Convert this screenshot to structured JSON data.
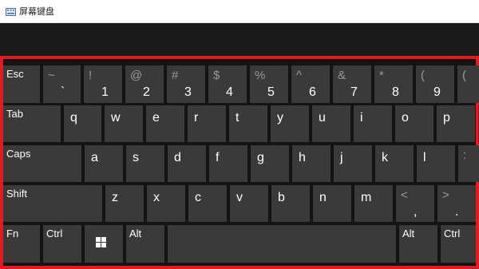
{
  "window": {
    "title": "屏幕键盘",
    "icon": "keyboard-icon"
  },
  "colors": {
    "highlight_border": "#e21b22",
    "key_bg": "#3a3a3a",
    "keyboard_bg": "#141414"
  },
  "keys": {
    "esc": "Esc",
    "tilde": {
      "shift": "~",
      "char": "`"
    },
    "1": {
      "shift": "!",
      "char": "1"
    },
    "2": {
      "shift": "@",
      "char": "2"
    },
    "3": {
      "shift": "#",
      "char": "3"
    },
    "4": {
      "shift": "$",
      "char": "4"
    },
    "5": {
      "shift": "%",
      "char": "5"
    },
    "6": {
      "shift": "^",
      "char": "6"
    },
    "7": {
      "shift": "&",
      "char": "7"
    },
    "8": {
      "shift": "*",
      "char": "8"
    },
    "9": {
      "shift": "(",
      "char": "9"
    },
    "0": {
      "shift": "(",
      "char": ""
    },
    "tab": "Tab",
    "q": "q",
    "w": "w",
    "e": "e",
    "r": "r",
    "t": "t",
    "y": "y",
    "u": "u",
    "i": "i",
    "o": "o",
    "p": "p",
    "caps": "Caps",
    "a": "a",
    "s": "s",
    "d": "d",
    "f": "f",
    "g": "g",
    "h": "h",
    "j": "j",
    "k": "k",
    "l": "l",
    "semicolon": {
      "shift": ":",
      "char": ""
    },
    "shift": "Shift",
    "z": "z",
    "x": "x",
    "c": "c",
    "v": "v",
    "b": "b",
    "n": "n",
    "m": "m",
    "comma": {
      "shift": "<",
      "char": ","
    },
    "period": {
      "shift": ">",
      "char": "."
    },
    "fn": "Fn",
    "ctrl_left": "Ctrl",
    "win_icon": "windows-icon",
    "alt_left": "Alt",
    "alt_right": "Alt",
    "ctrl_right": "Ctrl"
  }
}
